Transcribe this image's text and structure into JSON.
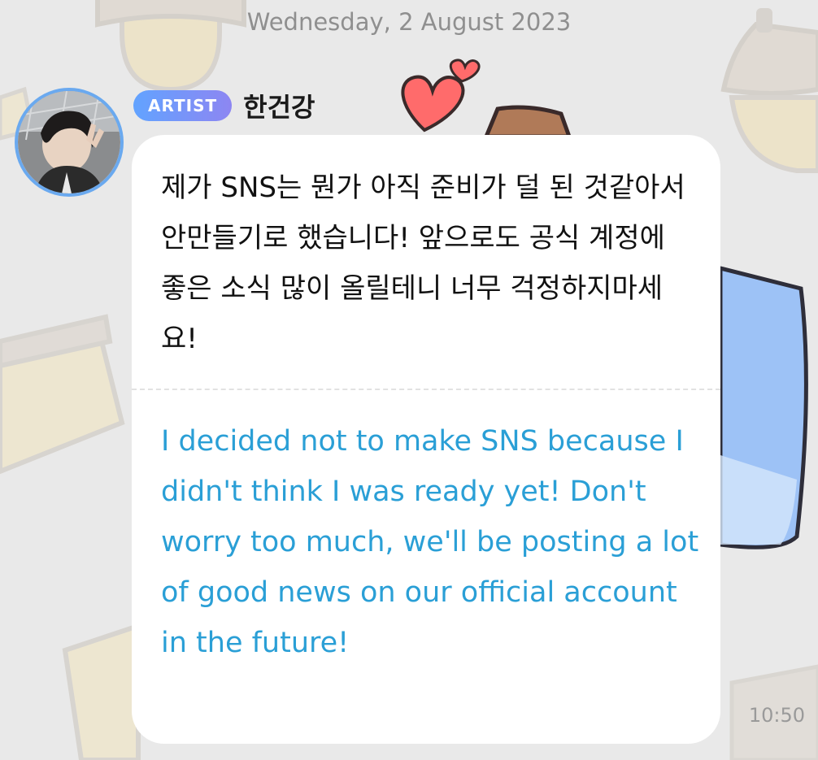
{
  "chat": {
    "date_header": "Wednesday, 2 August 2023",
    "message": {
      "badge": "ARTIST",
      "sender": "한건강",
      "text_korean": "제가 SNS는 뭔가 아직 준비가 덜 된 것같아서 안만들기로 했습니다! 앞으로도 공식 계정에 좋은 소식 많이 올릴테니 너무 걱정하지마세요!",
      "text_english": "I decided not to make SNS because I didn't think I was ready yet! Don't worry too much, we'll be posting a lot of good news on our official account in the future!",
      "time": "10:50"
    }
  },
  "theme": {
    "background": "#e9e9e9",
    "bubble": "#ffffff",
    "translation_color": "#2a9fd6",
    "badge_gradient": [
      "#62a3ff",
      "#8d86f2"
    ],
    "avatar_ring": "#6aa9ef"
  },
  "icons": {
    "background_pattern": [
      "acorn-icon",
      "cake-slice-icon",
      "heart-icon",
      "cat-ear-icon",
      "pillow-icon"
    ],
    "avatar": "profile-photo"
  }
}
